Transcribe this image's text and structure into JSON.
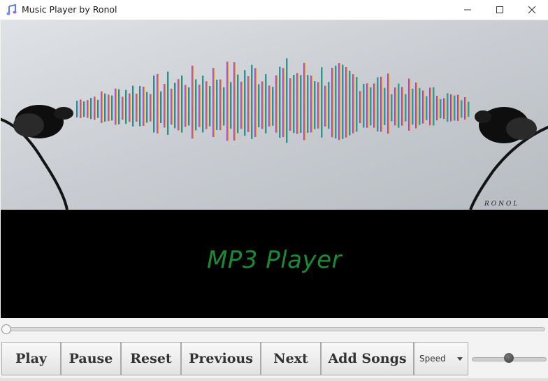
{
  "window": {
    "title": "Music Player by Ronol",
    "icon": "music-note-icon",
    "controls": [
      "minimize-icon",
      "maximize-icon",
      "close-icon"
    ]
  },
  "artwork": {
    "signature": "RONOL",
    "description_icon": "earphones-sound-wave"
  },
  "display": {
    "title": "MP3 Player"
  },
  "progress": {
    "value": 0
  },
  "controls": {
    "play_label": "Play",
    "pause_label": "Pause",
    "reset_label": "Reset",
    "previous_label": "Previous",
    "next_label": "Next",
    "add_songs_label": "Add Songs",
    "speed_label": "Speed"
  },
  "volume": {
    "value": 0.5
  },
  "colors": {
    "display_text": "#1a8a34",
    "display_bg": "#000000"
  }
}
